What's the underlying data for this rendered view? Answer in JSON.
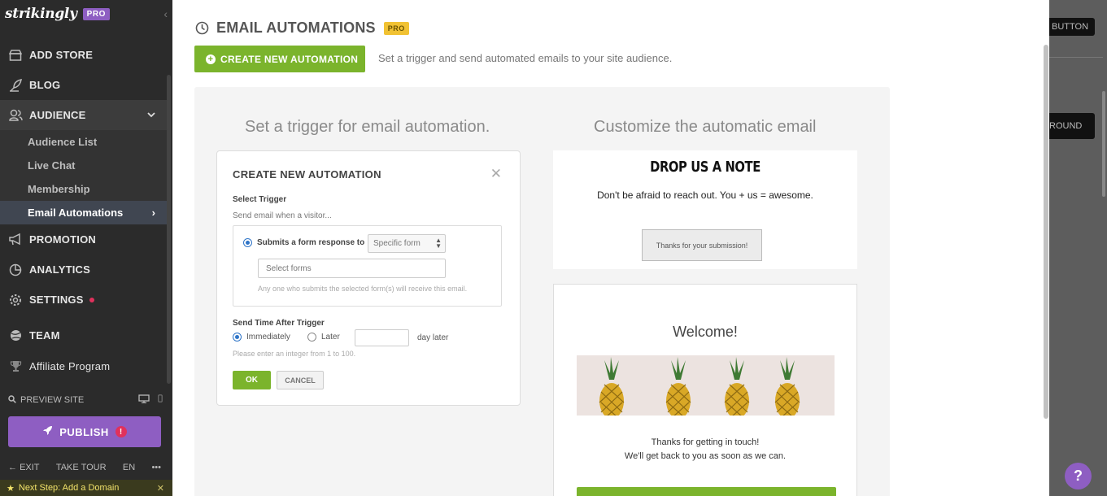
{
  "sidebar": {
    "logo": "strikingly",
    "pro_badge": "PRO",
    "nav": [
      {
        "label": "ADD STORE",
        "icon": "store-icon"
      },
      {
        "label": "BLOG",
        "icon": "quill-icon"
      },
      {
        "label": "AUDIENCE",
        "icon": "audience-icon",
        "expanded": true
      },
      {
        "label": "PROMOTION",
        "icon": "megaphone-icon"
      },
      {
        "label": "ANALYTICS",
        "icon": "pie-chart-icon"
      },
      {
        "label": "SETTINGS",
        "icon": "gear-icon",
        "notification_dot": true
      },
      {
        "label": "TEAM",
        "icon": "globe-icon"
      },
      {
        "label": "Affiliate Program",
        "icon": "trophy-icon"
      }
    ],
    "audience_sub": [
      {
        "label": "Audience List"
      },
      {
        "label": "Live Chat"
      },
      {
        "label": "Membership"
      },
      {
        "label": "Email Automations",
        "selected": true
      }
    ],
    "preview_site": "PREVIEW SITE",
    "publish": "PUBLISH",
    "publish_alert": "!",
    "exit": "EXIT",
    "take_tour": "TAKE TOUR",
    "language": "EN",
    "more": "•••",
    "next_step": "Next Step: Add a Domain"
  },
  "main": {
    "title": "EMAIL AUTOMATIONS",
    "pro_badge": "PRO",
    "create_button": "CREATE NEW AUTOMATION",
    "subtitle": "Set a trigger and send automated emails to your site audience.",
    "left_heading": "Set a trigger for email automation.",
    "right_heading": "Customize the automatic email"
  },
  "modal": {
    "title": "CREATE NEW AUTOMATION",
    "select_trigger": "Select Trigger",
    "send_email_when": "Send email when a visitor...",
    "option_label": "Submits a form response to",
    "form_select_value": "Specific form",
    "select_forms_placeholder": "Select forms",
    "hint": "Any one who submits the selected form(s) will receive this email.",
    "send_time_label": "Send Time After Trigger",
    "immediately": "Immediately",
    "later": "Later",
    "day_later": "day later",
    "integer_hint": "Please enter an integer  from 1 to 100.",
    "ok": "OK",
    "cancel": "CANCEL",
    "send_time_selected": "Immediately"
  },
  "preview1": {
    "title": "DROP US A NOTE",
    "subtitle": "Don't be afraid to reach out. You + us = awesome.",
    "button": "Thanks for your submission!"
  },
  "preview2": {
    "welcome": "Welcome!",
    "line1": "Thanks for getting in touch!",
    "line2": "We'll get back to you as soon as we can."
  },
  "right_edge": {
    "button1_fragment": "BUTTON",
    "button2_fragment": "ROUND",
    "help": "?"
  },
  "colors": {
    "accent_green": "#7bb42c",
    "brand_purple": "#8e5ec2",
    "pro_yellow": "#f1c233",
    "alert_red": "#e0315c"
  }
}
